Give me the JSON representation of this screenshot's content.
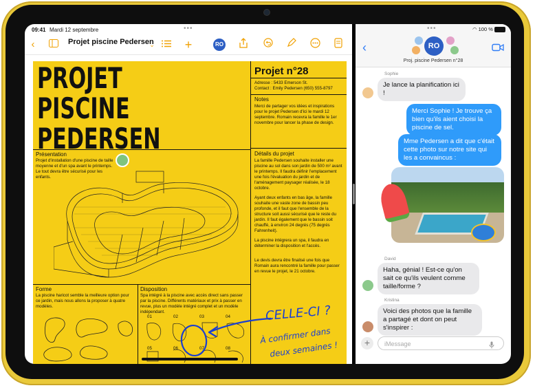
{
  "status": {
    "time": "09:41",
    "date": "Mardi 12 septembre",
    "battery": "100 %"
  },
  "toolbar": {
    "doc_title": "Projet piscine Pedersen",
    "avatar_initials": "RO",
    "accent": "#f0a000"
  },
  "document": {
    "headline_1": "PROJET",
    "headline_2": "PISCINE PEDERSEN",
    "project_number": "Projet n°28",
    "address": "Adresse : 5433 Emerson St.",
    "contact": "Contact : Emily Pedersen (650) 555-8797",
    "notes_label": "Notes",
    "notes_text": "Merci de partager vos idées et inspirations pour le projet Pedersen d'ici le mardi 12 septembre. Romain recevra la famille le 1er novembre pour lancer la phase de design.",
    "presentation_label": "Présentation",
    "presentation_text": "Projet d'installation d'une piscine de taille moyenne et d'un spa avant le printemps. Le tout devra être sécurisé pour les enfants.",
    "details_label": "Détails du projet",
    "details_p1": "La famille Pedersen souhaite installer une piscine au sol dans son jardin de 500 m² avant le printemps. Il faudra définir l'emplacement une fois l'évaluation du jardin et de l'aménagement paysager réalisée, le 18 octobre.",
    "details_p2": "Ayant deux enfants en bas âge, la famille souhaite une vaste zone de bassin peu profonde, et il faut que l'ensemble de la structure soit aussi sécurisé que le reste du jardin. Il faut également que le bassin soit chauffé, à environ 24 degrés (75 degrés Fahrenheit).",
    "details_p3": "La piscine intégrera un spa, il faudra en déterminer la disposition et l'accès.",
    "details_p4": "Le devis devra être finalisé une fois que Romain aura rencontré la famille pour passer en revue le projet, le 21 octobre.",
    "forme_label": "Forme",
    "forme_text": "La piscine haricot semble la meilleure option pour ce jardin, mais nous allons la proposer à quatre modèles.",
    "disposition_label": "Disposition",
    "disposition_text": "Spa intégré à la piscine avec accès direct sans passer par la piscine. Différents matériaux et prix à passer en revue, plus un modèle intégré complet et un modèle indépendant.",
    "grid_labels": [
      "01",
      "02",
      "03",
      "04",
      "05",
      "06",
      "07",
      "08"
    ],
    "handwriting_1": "CELLE-CI ?",
    "handwriting_2": "À confirmer dans",
    "handwriting_3": "deux semaines !",
    "ink_color": "#1b3fd0",
    "paper_color": "#f5cd16"
  },
  "messages": {
    "group_name": "Proj. piscine Pedersen n°28",
    "avatar_initials": "RO",
    "thread": [
      {
        "sender": "Sophie",
        "dir": "in",
        "text": "Je lance la planification ici !"
      },
      {
        "dir": "out",
        "text": "Merci Sophie ! Je trouve ça bien qu'ils aient choisi la piscine de sel."
      },
      {
        "dir": "out",
        "text": "Mme Pedersen a dit que c'était cette photo sur notre site qui les a convaincus :"
      },
      {
        "sender": "David",
        "dir": "in",
        "text": "Haha, génial ! Est-ce qu'on sait ce qu'ils veulent comme taille/forme ?"
      },
      {
        "sender": "Kristina",
        "dir": "in",
        "text": "Voici des photos que la famille a partagé et dont on peut s'inspirer :"
      }
    ],
    "input_placeholder": "iMessage",
    "bubble_out_color": "#2f9bfa",
    "bubble_in_color": "#e9e9eb"
  }
}
